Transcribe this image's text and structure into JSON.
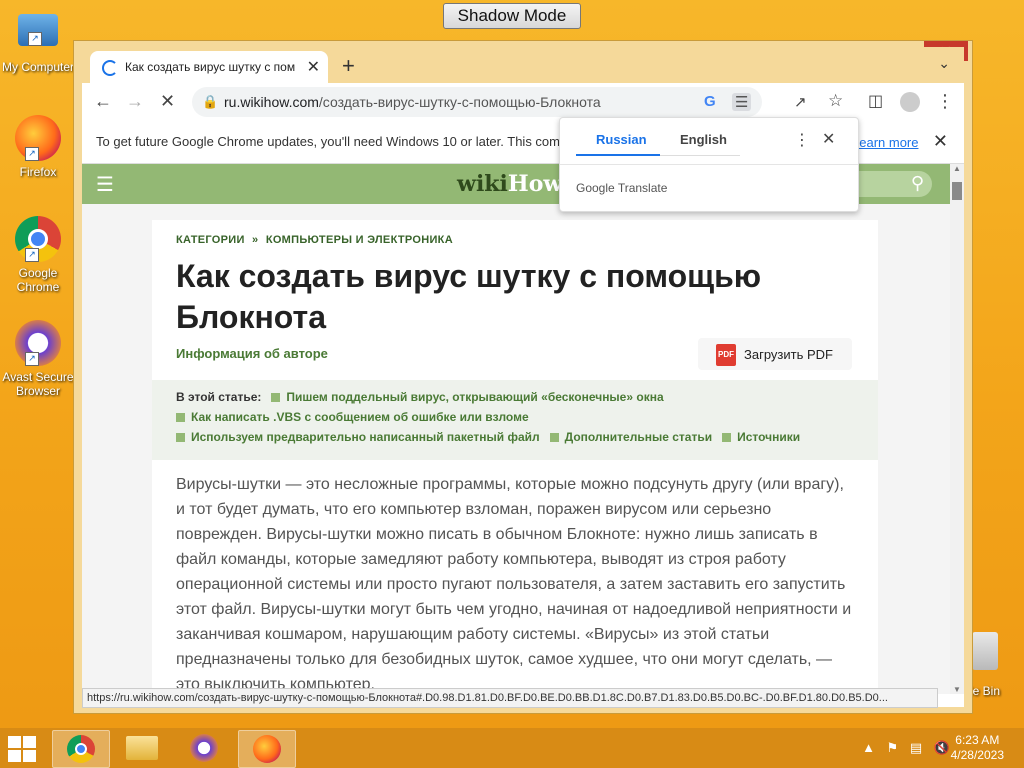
{
  "shadow_mode": "Shadow Mode",
  "desktop_icons": [
    {
      "label": "My Computer",
      "icon": "computer-icon"
    },
    {
      "label": "Firefox",
      "icon": "firefox-icon"
    },
    {
      "label": "Google Chrome",
      "icon": "chrome-icon"
    },
    {
      "label": "Avast Secure Browser",
      "icon": "avast-icon"
    },
    {
      "label": "cle Bin",
      "icon": "recycle-bin-icon"
    }
  ],
  "tab": {
    "title": "Как создать вирус шутку с помощ"
  },
  "address": {
    "domain": "ru.wikihow.com",
    "path": "/создать-вирус-шутку-с-помощью-Блокнота"
  },
  "infobar": {
    "text": "To get future Google Chrome updates, you'll need Windows 10 or later. This com",
    "link": "Learn more"
  },
  "translate": {
    "lang1": "Russian",
    "lang2": "English",
    "brand": "Google Translate"
  },
  "site": {
    "logo_a": "wiki",
    "logo_b": "How"
  },
  "article": {
    "crumb1": "КАТЕГОРИИ",
    "crumb_sep": "»",
    "crumb2": "КОМПЬЮТЕРЫ И ЭЛЕКТРОНИКА",
    "title": "Как создать вирус шутку с помощью Блокнота",
    "author": "Информация об авторе",
    "pdf": "Загрузить PDF",
    "toc_lead": "В этой статье:",
    "toc": [
      "Пишем поддельный вирус, открывающий «бесконечные» окна",
      "Как написать .VBS с сообщением об ошибке или взломе",
      "Используем предварительно написанный пакетный файл",
      "Дополнительные статьи",
      "Источники"
    ],
    "body": "Вирусы-шутки — это несложные программы, которые можно подсунуть другу (или врагу), и тот будет думать, что его компьютер взломан, поражен вирусом или серьезно поврежден. Вирусы-шутки можно писать в обычном Блокноте: нужно лишь записать в файл команды, которые замедляют работу компьютера, выводят из строя работу операционной системы или просто пугают пользователя, а затем заставить его запустить этот файл. Вирусы-шутки могут быть чем угодно, начиная от надоедливой неприятности и заканчивая кошмаром, нарушающим работу системы. «Вирусы» из этой статьи предназначены только для безобидных шуток, самое худшее, что они могут сделать, — это выключить компьютер."
  },
  "status_url": "https://ru.wikihow.com/создать-вирус-шутку-с-помощью-Блокнота#.D0.98.D1.81.D0.BF.D0.BE.D0.BB.D1.8C.D0.B7.D1.83.D0.B5.D0.BC-.D0.BF.D1.80.D0.B5.D0...",
  "clock": {
    "time": "6:23 AM",
    "date": "4/28/2023"
  }
}
